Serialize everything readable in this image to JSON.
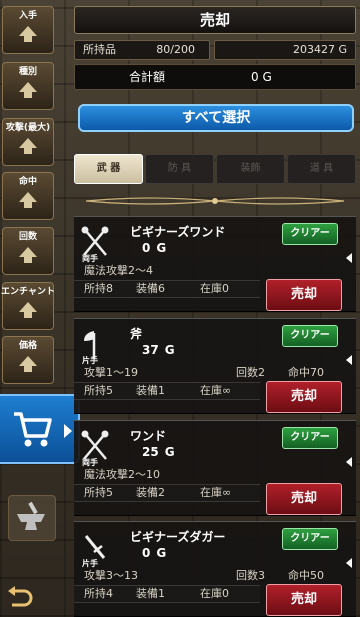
{
  "sidebar": {
    "filters": [
      {
        "label": "入手"
      },
      {
        "label": "種別"
      },
      {
        "label": "攻撃(最大)"
      },
      {
        "label": "命中"
      },
      {
        "label": "回数"
      },
      {
        "label": "エンチャント"
      },
      {
        "label": "価格"
      }
    ],
    "cart_icon": "shopping-cart-icon",
    "anvil_icon": "anvil-icon",
    "back_icon": "back-arrow-icon"
  },
  "header": {
    "title": "売却",
    "owned_label": "所持品",
    "owned_value": "80/200",
    "gold": "203427 G",
    "total_label": "合計額",
    "total_value": "0 G",
    "select_all": "すべて選択"
  },
  "tabs": [
    {
      "label": "武 器",
      "active": true
    },
    {
      "label": "防 具",
      "active": false
    },
    {
      "label": "装飾",
      "active": false
    },
    {
      "label": "道 具",
      "active": false
    }
  ],
  "items": [
    {
      "name": "ビギナーズワンド",
      "price": "0",
      "currency": "G",
      "hand": "両手",
      "icon": "wand-icon",
      "stat": "魔法攻撃2～4",
      "count": "",
      "hit": "",
      "owned": "所持8",
      "equipped": "装備6",
      "stock": "在庫0",
      "clear_label": "クリアー",
      "sell_label": "売却"
    },
    {
      "name": "斧",
      "price": "37",
      "currency": "G",
      "hand": "片手",
      "icon": "axe-icon",
      "stat": "攻撃1～19",
      "count": "回数2",
      "hit": "命中70",
      "owned": "所持5",
      "equipped": "装備1",
      "stock": "在庫∞",
      "clear_label": "クリアー",
      "sell_label": "売却"
    },
    {
      "name": "ワンド",
      "price": "25",
      "currency": "G",
      "hand": "両手",
      "icon": "wand-icon",
      "stat": "魔法攻撃2～10",
      "count": "",
      "hit": "",
      "owned": "所持5",
      "equipped": "装備2",
      "stock": "在庫∞",
      "clear_label": "クリアー",
      "sell_label": "売却"
    },
    {
      "name": "ビギナーズダガー",
      "price": "0",
      "currency": "G",
      "hand": "片手",
      "icon": "dagger-icon",
      "stat": "攻撃3～13",
      "count": "回数3",
      "hit": "命中50",
      "owned": "所持4",
      "equipped": "装備1",
      "stock": "在庫0",
      "clear_label": "クリアー",
      "sell_label": "売却"
    }
  ]
}
